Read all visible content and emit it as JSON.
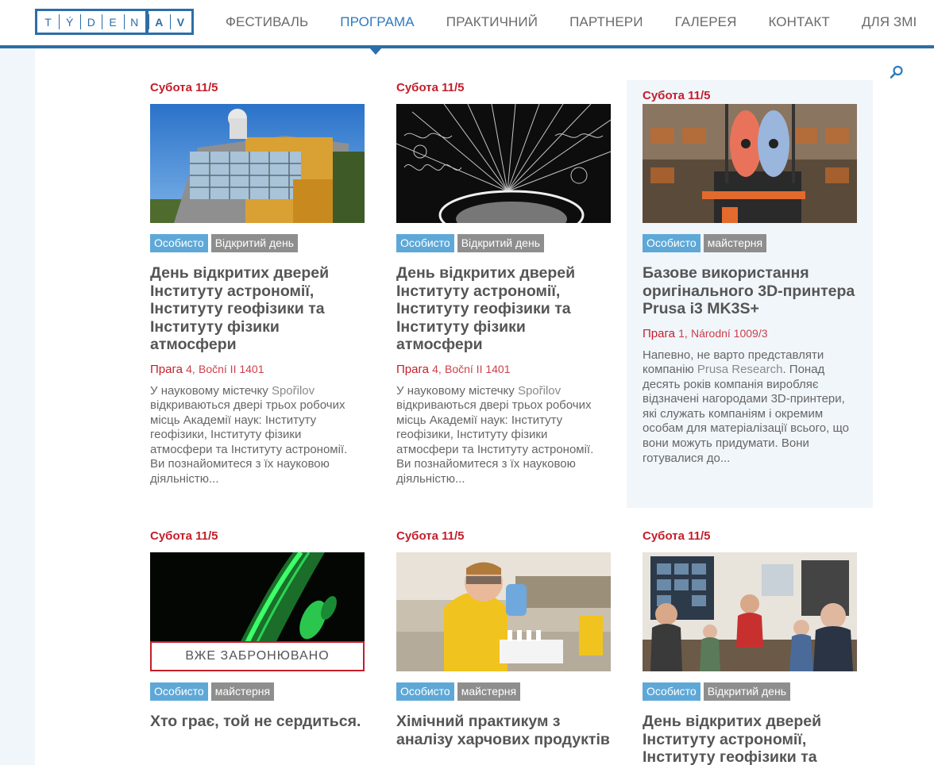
{
  "logo": {
    "letters": [
      "T",
      "Ý",
      "D",
      "E",
      "N",
      "A",
      "V"
    ]
  },
  "nav": [
    {
      "label": "ФЕСТИВАЛЬ",
      "active": false
    },
    {
      "label": "ПРОГРАМА",
      "active": true
    },
    {
      "label": "ПРАКТИЧНИЙ",
      "active": false
    },
    {
      "label": "ПАРТНЕРИ",
      "active": false
    },
    {
      "label": "ГАЛЕРЕЯ",
      "active": false
    },
    {
      "label": "КОНТАКТ",
      "active": false
    },
    {
      "label": "ДЛЯ ЗМІ",
      "active": false
    }
  ],
  "colors": {
    "brand": "#2c6ea8",
    "active_nav": "#2c7bbf",
    "date_red": "#c41e2a",
    "tag_blue": "#5ea8d8",
    "tag_gray": "#8e8e8e",
    "highlight_bg": "#f1f6fb"
  },
  "search_icon": "search-icon",
  "events": [
    {
      "date": "Субота 11/5",
      "tags": [
        "Особисто",
        "Відкритий день"
      ],
      "title": "День відкритих дверей Інституту астрономії, Інституту геофізики та Інституту фізики атмосфери",
      "place_city": "Прага",
      "place_num": "4,",
      "place_addr": "Boční II 1401",
      "desc_a": "У науковому містечку ",
      "desc_hl": "Spořilov",
      "desc_b": " відкриваються двері трьох робочих місць Академії наук: Інституту геофізики, Інституту фізики атмосфери та Інституту астрономії. Ви познайомитеся з їх науковою діяльністю..."
    },
    {
      "date": "Субота 11/5",
      "tags": [
        "Особисто",
        "Відкритий день"
      ],
      "title": "День відкритих дверей Інституту астрономії, Інституту геофізики та Інституту фізики атмосфери",
      "place_city": "Прага",
      "place_num": "4,",
      "place_addr": "Boční II 1401",
      "desc_a": "У науковому містечку ",
      "desc_hl": "Spořilov",
      "desc_b": " відкриваються двері трьох робочих місць Академії наук: Інституту геофізики, Інституту фізики атмосфери та Інституту астрономії. Ви познайомитеся з їх науковою діяльністю..."
    },
    {
      "date": "Субота 11/5",
      "tags": [
        "Особисто",
        "майстерня"
      ],
      "title": "Базове використання оригінального 3D-принтера Prusa i3 MK3S+",
      "place_city": "Прага",
      "place_num": "1,",
      "place_addr": "Národní 1009/3",
      "desc_a": "Напевно, не варто представляти компанію ",
      "desc_hl": "Prusa Research",
      "desc_b": ". Понад десять років компанія виробляє відзначені нагородами 3D-принтери, які служать компаніям і окремим особам для матеріалізації всього, що вони можуть придумати. Вони готувалися до..."
    },
    {
      "date": "Субота 11/5",
      "tags": [
        "Особисто",
        "майстерня"
      ],
      "booked": "ВЖЕ ЗАБРОНЮВАНО",
      "title": "Хто грає, той не сердиться."
    },
    {
      "date": "Субота 11/5",
      "tags": [
        "Особисто",
        "майстерня"
      ],
      "title": "Хімічний практикум з аналізу харчових продуктів"
    },
    {
      "date": "Субота 11/5",
      "tags": [
        "Особисто",
        "Відкритий день"
      ],
      "title": "День відкритих дверей Інституту астрономії, Інституту геофізики та"
    }
  ]
}
